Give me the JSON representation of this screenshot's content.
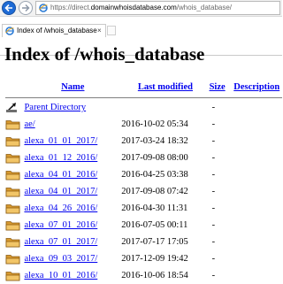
{
  "browser": {
    "url_prefix": "https://direct.",
    "url_host": "domainwhoisdatabase.com",
    "url_path": "/whois_database/",
    "tab_title": "Index of /whois_database",
    "tab_close": "×"
  },
  "page": {
    "heading": "Index of /whois_database",
    "columns": {
      "name": "Name",
      "last_modified": "Last modified",
      "size": "Size",
      "description": "Description"
    },
    "parent": {
      "name": "Parent Directory",
      "size": "-"
    },
    "rows": [
      {
        "name": "ae/",
        "modified": "2016-10-02 05:34",
        "size": "-"
      },
      {
        "name": "alexa_01_01_2017/",
        "modified": "2017-03-24 18:32",
        "size": "-"
      },
      {
        "name": "alexa_01_12_2016/",
        "modified": "2017-09-08 08:00",
        "size": "-"
      },
      {
        "name": "alexa_04_01_2016/",
        "modified": "2016-04-25 03:38",
        "size": "-"
      },
      {
        "name": "alexa_04_01_2017/",
        "modified": "2017-09-08 07:42",
        "size": "-"
      },
      {
        "name": "alexa_04_26_2016/",
        "modified": "2016-04-30 11:31",
        "size": "-"
      },
      {
        "name": "alexa_07_01_2016/",
        "modified": "2016-07-05 00:11",
        "size": "-"
      },
      {
        "name": "alexa_07_01_2017/",
        "modified": "2017-07-17 17:05",
        "size": "-"
      },
      {
        "name": "alexa_09_03_2017/",
        "modified": "2017-12-09 19:42",
        "size": "-"
      },
      {
        "name": "alexa_10_01_2016/",
        "modified": "2016-10-06 18:54",
        "size": "-"
      }
    ]
  },
  "icons": {
    "back": "back-arrow-icon",
    "forward": "forward-arrow-icon",
    "favicon": "ie-favicon-icon",
    "parent": "parent-directory-icon",
    "folder": "folder-icon"
  },
  "colors": {
    "link": "#0000ee",
    "back_button": "#1e6bd6",
    "folder": "#e8b04a"
  }
}
